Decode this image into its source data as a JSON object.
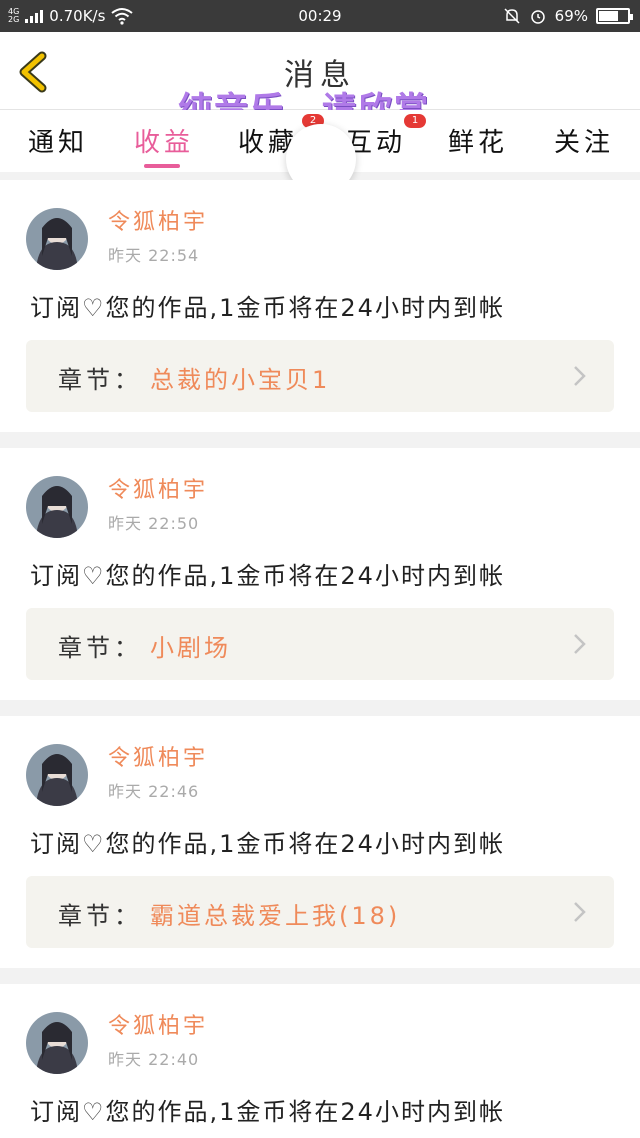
{
  "status_bar": {
    "network_top": "4G",
    "network_bottom": "2G",
    "speed": "0.70K/s",
    "time": "00:29",
    "battery": "69%",
    "battery_level": 0.69
  },
  "header": {
    "title": "消息",
    "overlay": "纯音乐，请欣赏"
  },
  "tabs": [
    {
      "label": "通知",
      "active": false,
      "badge": ""
    },
    {
      "label": "收益",
      "active": true,
      "badge": ""
    },
    {
      "label": "收藏",
      "active": false,
      "badge": "2"
    },
    {
      "label": "互动",
      "active": false,
      "badge": "1"
    },
    {
      "label": "鲜花",
      "active": false,
      "badge": ""
    },
    {
      "label": "关注",
      "active": false,
      "badge": ""
    }
  ],
  "messages": [
    {
      "name": "令狐柏宇",
      "time": "昨天 22:54",
      "text_before": "订阅",
      "text_after": "您的作品,1金币将在24小时内到帐",
      "chapter_label": "章节：",
      "chapter_title": "总裁的小宝贝1"
    },
    {
      "name": "令狐柏宇",
      "time": "昨天 22:50",
      "text_before": "订阅",
      "text_after": "您的作品,1金币将在24小时内到帐",
      "chapter_label": "章节：",
      "chapter_title": "小剧场"
    },
    {
      "name": "令狐柏宇",
      "time": "昨天 22:46",
      "text_before": "订阅",
      "text_after": "您的作品,1金币将在24小时内到帐",
      "chapter_label": "章节：",
      "chapter_title": "霸道总裁爱上我(18)"
    },
    {
      "name": "令狐柏宇",
      "time": "昨天 22:40",
      "text_before": "订阅",
      "text_after": "您的作品,1金币将在24小时内到帐",
      "chapter_label": "",
      "chapter_title": ""
    }
  ],
  "icons": {
    "back": "chevron-left-icon",
    "heart": "broken-heart-icon",
    "chapter_arrow": "chevron-right-icon"
  },
  "colors": {
    "accent_pink": "#e85d9a",
    "accent_orange": "#ef8a5a",
    "back_yellow": "#f2c200"
  }
}
